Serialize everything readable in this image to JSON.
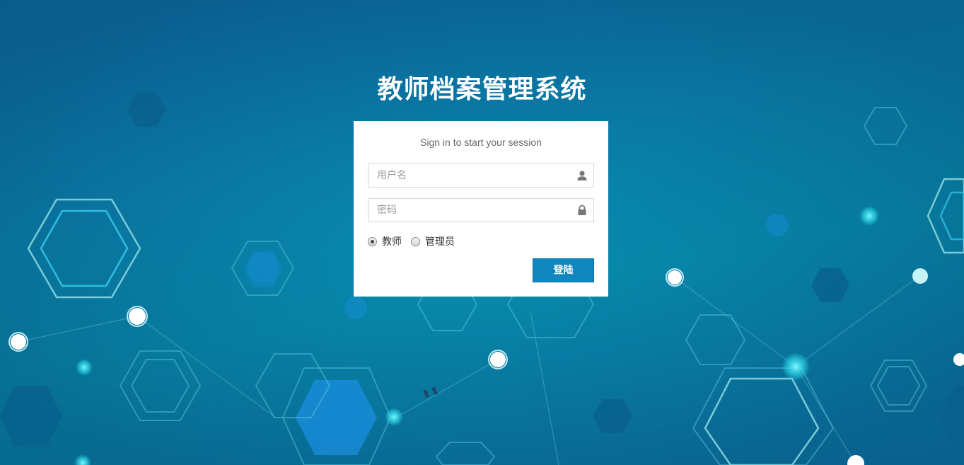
{
  "app": {
    "title": "教师档案管理系统"
  },
  "login": {
    "message": "Sign in to start your session",
    "username_placeholder": "用户名",
    "password_placeholder": "密码",
    "username_value": "",
    "password_value": "",
    "roles": [
      {
        "label": "教师",
        "checked": true
      },
      {
        "label": "管理员",
        "checked": false
      }
    ],
    "submit_label": "登陆"
  },
  "icons": {
    "username": "user-icon",
    "password": "lock-icon"
  },
  "colors": {
    "background": "#0a86b0",
    "button": "#0f87bd",
    "title_text": "#ffffff"
  }
}
